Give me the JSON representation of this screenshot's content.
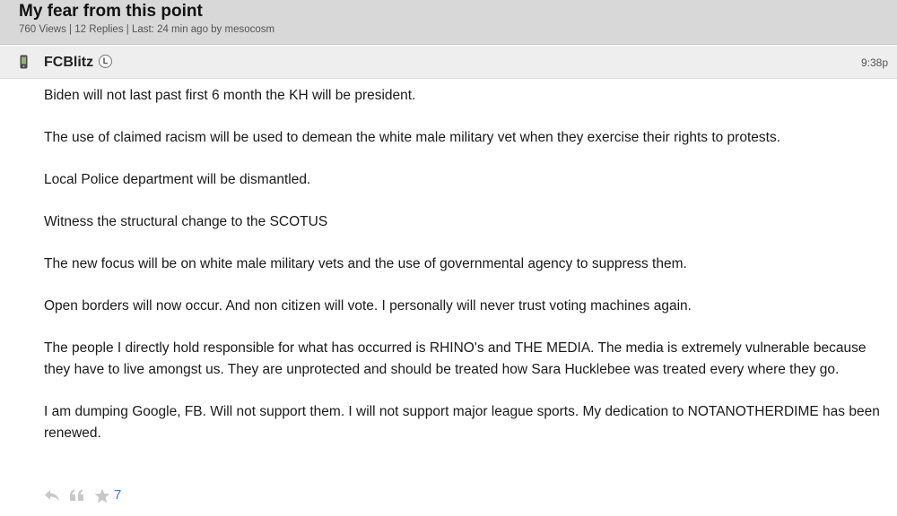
{
  "thread": {
    "title": "My fear from this point",
    "meta": "760 Views | 12 Replies | Last: 24 min ago by mesocosm"
  },
  "post": {
    "username": "FCBlitz",
    "badge": "L",
    "time": "9:38p",
    "paragraphs": [
      "Biden will not last past first 6 month the KH will be president.",
      "The use of claimed racism will be used to demean the white male military vet when they exercise their rights to protests.",
      "Local Police department will be dismantled.",
      "Witness the structural change to the SCOTUS",
      "The new focus will be on white male military vets and the use of governmental agency to suppress them.",
      "Open borders will now occur. And non citizen will vote. I personally will never trust voting machines again.",
      "The people I directly hold responsible for what has occurred is RHINO's and THE MEDIA. The media is extremely vulnerable because they have to live amongst us. They are unprotected and should be treated how Sara Hucklebee was treated every where they go.",
      "I am dumping Google, FB. Will not support them. I will not support major league sports. My dedication to NOTANOTHERDIME has been renewed."
    ],
    "star_count": "7"
  },
  "icons": {
    "device": "mobile-phone-icon",
    "reply": "reply-arrow-icon",
    "quote": "quote-icon",
    "star": "star-icon"
  },
  "colors": {
    "header_bg": "#d8d8d8",
    "post_header_bg": "#eeeeee",
    "star_count": "#3a78c3",
    "icon_gray": "#c8c8c8"
  }
}
